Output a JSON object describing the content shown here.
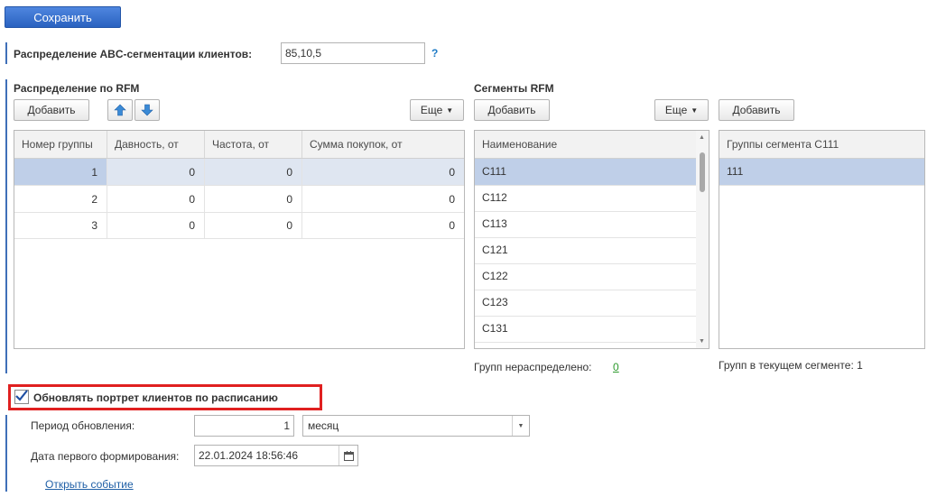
{
  "toolbar": {
    "save_label": "Сохранить"
  },
  "abc": {
    "label": "Распределение ABC-сегментации клиентов:",
    "value": "85,10,5",
    "help": "?"
  },
  "rfm": {
    "title": "Распределение по RFM",
    "add_label": "Добавить",
    "more_label": "Еще",
    "columns": [
      "Номер группы",
      "Давность, от",
      "Частота, от",
      "Сумма покупок, от"
    ],
    "rows": [
      [
        "1",
        "0",
        "0",
        "0"
      ],
      [
        "2",
        "0",
        "0",
        "0"
      ],
      [
        "3",
        "0",
        "0",
        "0"
      ]
    ]
  },
  "segments": {
    "title": "Сегменты RFM",
    "add_label": "Добавить",
    "more_label": "Еще",
    "column": "Наименование",
    "items": [
      "С111",
      "С112",
      "С113",
      "С121",
      "С122",
      "С123",
      "С131"
    ],
    "footer_label": "Групп нераспределено:",
    "footer_value": "0"
  },
  "groups": {
    "add_label": "Добавить",
    "column": "Группы сегмента С111",
    "items": [
      "111"
    ],
    "footer": "Групп в текущем сегменте: 1"
  },
  "schedule": {
    "checkbox_label": "Обновлять портрет клиентов по расписанию",
    "checked": true,
    "period_label": "Период обновления:",
    "period_value": "1",
    "period_unit": "месяц",
    "date_label": "Дата первого формирования:",
    "date_value": "22.01.2024 18:56:46",
    "open_event": "Открыть событие"
  },
  "colors": {
    "accent": "#3f6fb8",
    "selected_row": "#bfcfe8",
    "highlight_border": "#e02020",
    "link_green": "#2e9a2e"
  }
}
